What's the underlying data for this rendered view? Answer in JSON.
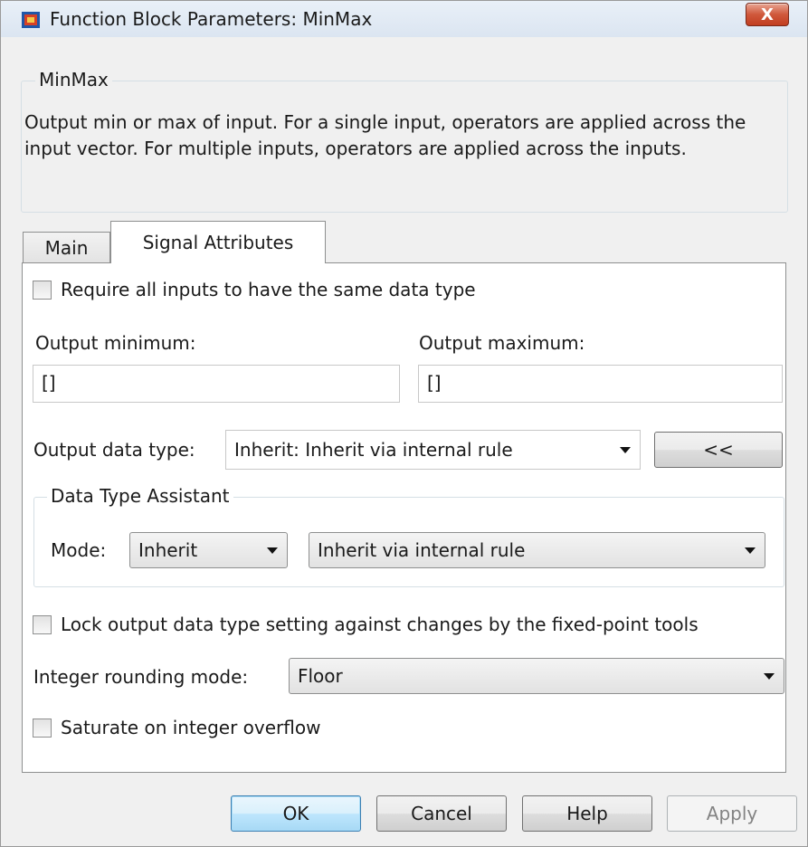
{
  "window": {
    "title": "Function Block Parameters: MinMax",
    "close_label": "X"
  },
  "block": {
    "name": "MinMax",
    "description": "Output min or max of input.  For a single input, operators are applied across the input vector.  For multiple inputs, operators are applied across the inputs."
  },
  "tabs": [
    {
      "label": "Main",
      "active": false
    },
    {
      "label": "Signal Attributes",
      "active": true
    }
  ],
  "signal_attributes": {
    "require_same_type": {
      "label": "Require all inputs to have the same data type",
      "checked": false
    },
    "output_minimum": {
      "label": "Output minimum:",
      "value": "[]"
    },
    "output_maximum": {
      "label": "Output maximum:",
      "value": "[]"
    },
    "output_data_type": {
      "label": "Output data type:",
      "value": "Inherit: Inherit via internal rule"
    },
    "collapse_button": "<<",
    "assistant": {
      "title": "Data Type Assistant",
      "mode_label": "Mode:",
      "mode_value": "Inherit",
      "rule_value": "Inherit via internal rule"
    },
    "lock_output": {
      "label": "Lock output data type setting against changes by the fixed-point tools",
      "checked": false
    },
    "rounding_mode": {
      "label": "Integer rounding mode:",
      "value": "Floor"
    },
    "saturate": {
      "label": "Saturate on integer overflow",
      "checked": false
    }
  },
  "buttons": {
    "ok": "OK",
    "cancel": "Cancel",
    "help": "Help",
    "apply": "Apply"
  },
  "icons": {
    "app": "simulink-block-icon",
    "close": "close-icon",
    "dropdown": "chevron-down-icon"
  }
}
